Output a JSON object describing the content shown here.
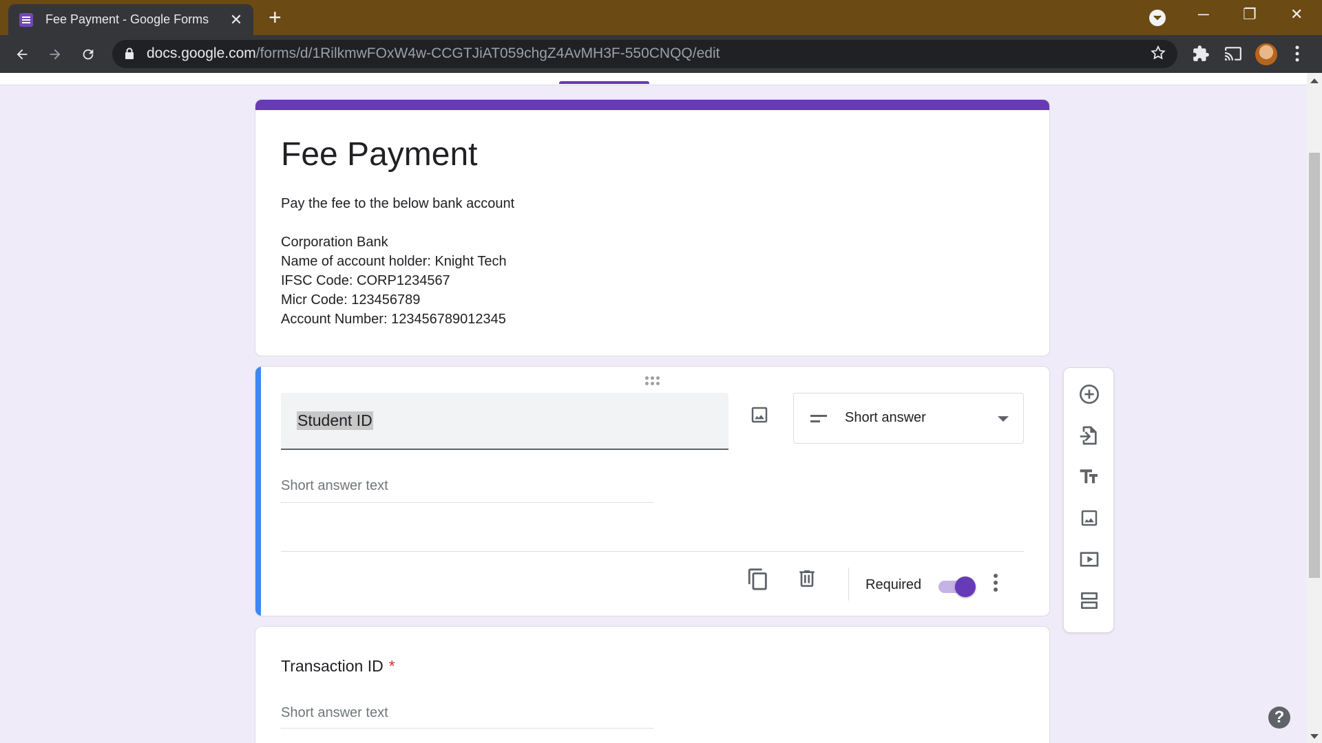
{
  "browser": {
    "tab_title": "Fee Payment - Google Forms",
    "url_host": "docs.google.com",
    "url_path": "/forms/d/1RilkmwFOxW4w-CCGTJiAT059chgZ4AvMH3F-550CNQQ/edit",
    "new_tab": "+",
    "close_tab": "✕"
  },
  "form": {
    "title": "Fee Payment",
    "description": "Pay the fee to the below bank account\n\nCorporation Bank\nName of account holder: Knight Tech\nIFSC Code: CORP1234567\nMicr Code: 123456789\nAccount Number: 123456789012345",
    "theme_color": "#673ab7"
  },
  "question1": {
    "title": "Student ID",
    "type_label": "Short answer",
    "answer_placeholder": "Short answer text",
    "required_label": "Required",
    "required": true
  },
  "question2": {
    "title": "Transaction ID",
    "required_mark": "*",
    "answer_placeholder": "Short answer text"
  },
  "side_toolbar": [
    "add-question-icon",
    "import-questions-icon",
    "add-title-icon",
    "add-image-icon",
    "add-video-icon",
    "add-section-icon"
  ],
  "help": "?"
}
